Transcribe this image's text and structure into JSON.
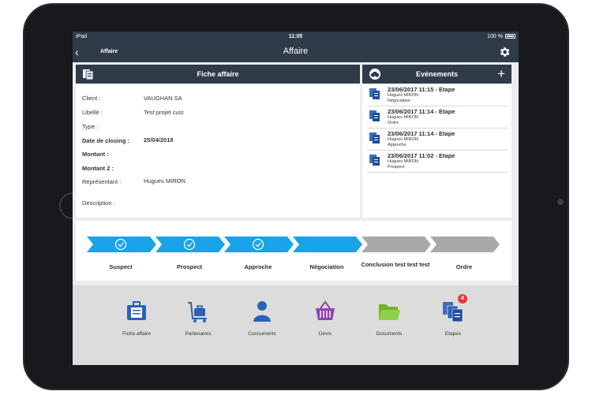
{
  "status": {
    "device": "iPad",
    "time": "11:05",
    "battery": "100 %"
  },
  "nav": {
    "back_label": "Affaire",
    "title": "Affaire"
  },
  "fiche": {
    "title": "Fiche affaire",
    "fields": [
      {
        "label": "Client :",
        "value": "VAUGHAN SA"
      },
      {
        "label": "Libellé :",
        "value": "Test projet cust"
      },
      {
        "label": "Type :",
        "value": ""
      },
      {
        "label": "Date de closing :",
        "value": "25/04/2018"
      },
      {
        "label": "Montant :",
        "value": ""
      },
      {
        "label": "Montant 2 :",
        "value": ""
      },
      {
        "label": "Représentant :",
        "value": "Hugues MIRON"
      },
      {
        "label": "Description :",
        "value": ""
      }
    ]
  },
  "events": {
    "title": "Evénements",
    "items": [
      {
        "title": "23/06/2017 11:15 - Etape",
        "user": "Hugues MIRON",
        "stage": "Négociation"
      },
      {
        "title": "23/06/2017 11:14 - Etape",
        "user": "Hugues MIRON",
        "stage": "Ordre"
      },
      {
        "title": "23/06/2017 11:14 - Etape",
        "user": "Hugues MIRON",
        "stage": "Approche"
      },
      {
        "title": "23/06/2017 11:02 - Etape",
        "user": "Hugues MIRON",
        "stage": "Prospect"
      }
    ]
  },
  "pipeline": {
    "steps": [
      {
        "label": "Suspect",
        "done": true
      },
      {
        "label": "Prospect",
        "done": true
      },
      {
        "label": "Approche",
        "done": true
      },
      {
        "label": "Négociation",
        "done": false
      },
      {
        "label": "Conclusion test test test",
        "done": false
      },
      {
        "label": "Ordre",
        "done": false
      }
    ],
    "colors": {
      "active": "#1aa3e8",
      "inactive": "#a9a9a9"
    }
  },
  "toolbar": {
    "items": [
      {
        "label": "Fiche affaire",
        "icon": "briefcase-icon"
      },
      {
        "label": "Partenaires",
        "icon": "luggage-cart-icon"
      },
      {
        "label": "Concurrents",
        "icon": "person-icon"
      },
      {
        "label": "Devis",
        "icon": "basket-icon"
      },
      {
        "label": "Documents",
        "icon": "folder-icon"
      },
      {
        "label": "Etapes",
        "icon": "stages-icon"
      }
    ],
    "badge": "4"
  },
  "colors": {
    "navbar": "#2f3b49",
    "accent": "#1aa3e8",
    "badge": "#e53935"
  }
}
